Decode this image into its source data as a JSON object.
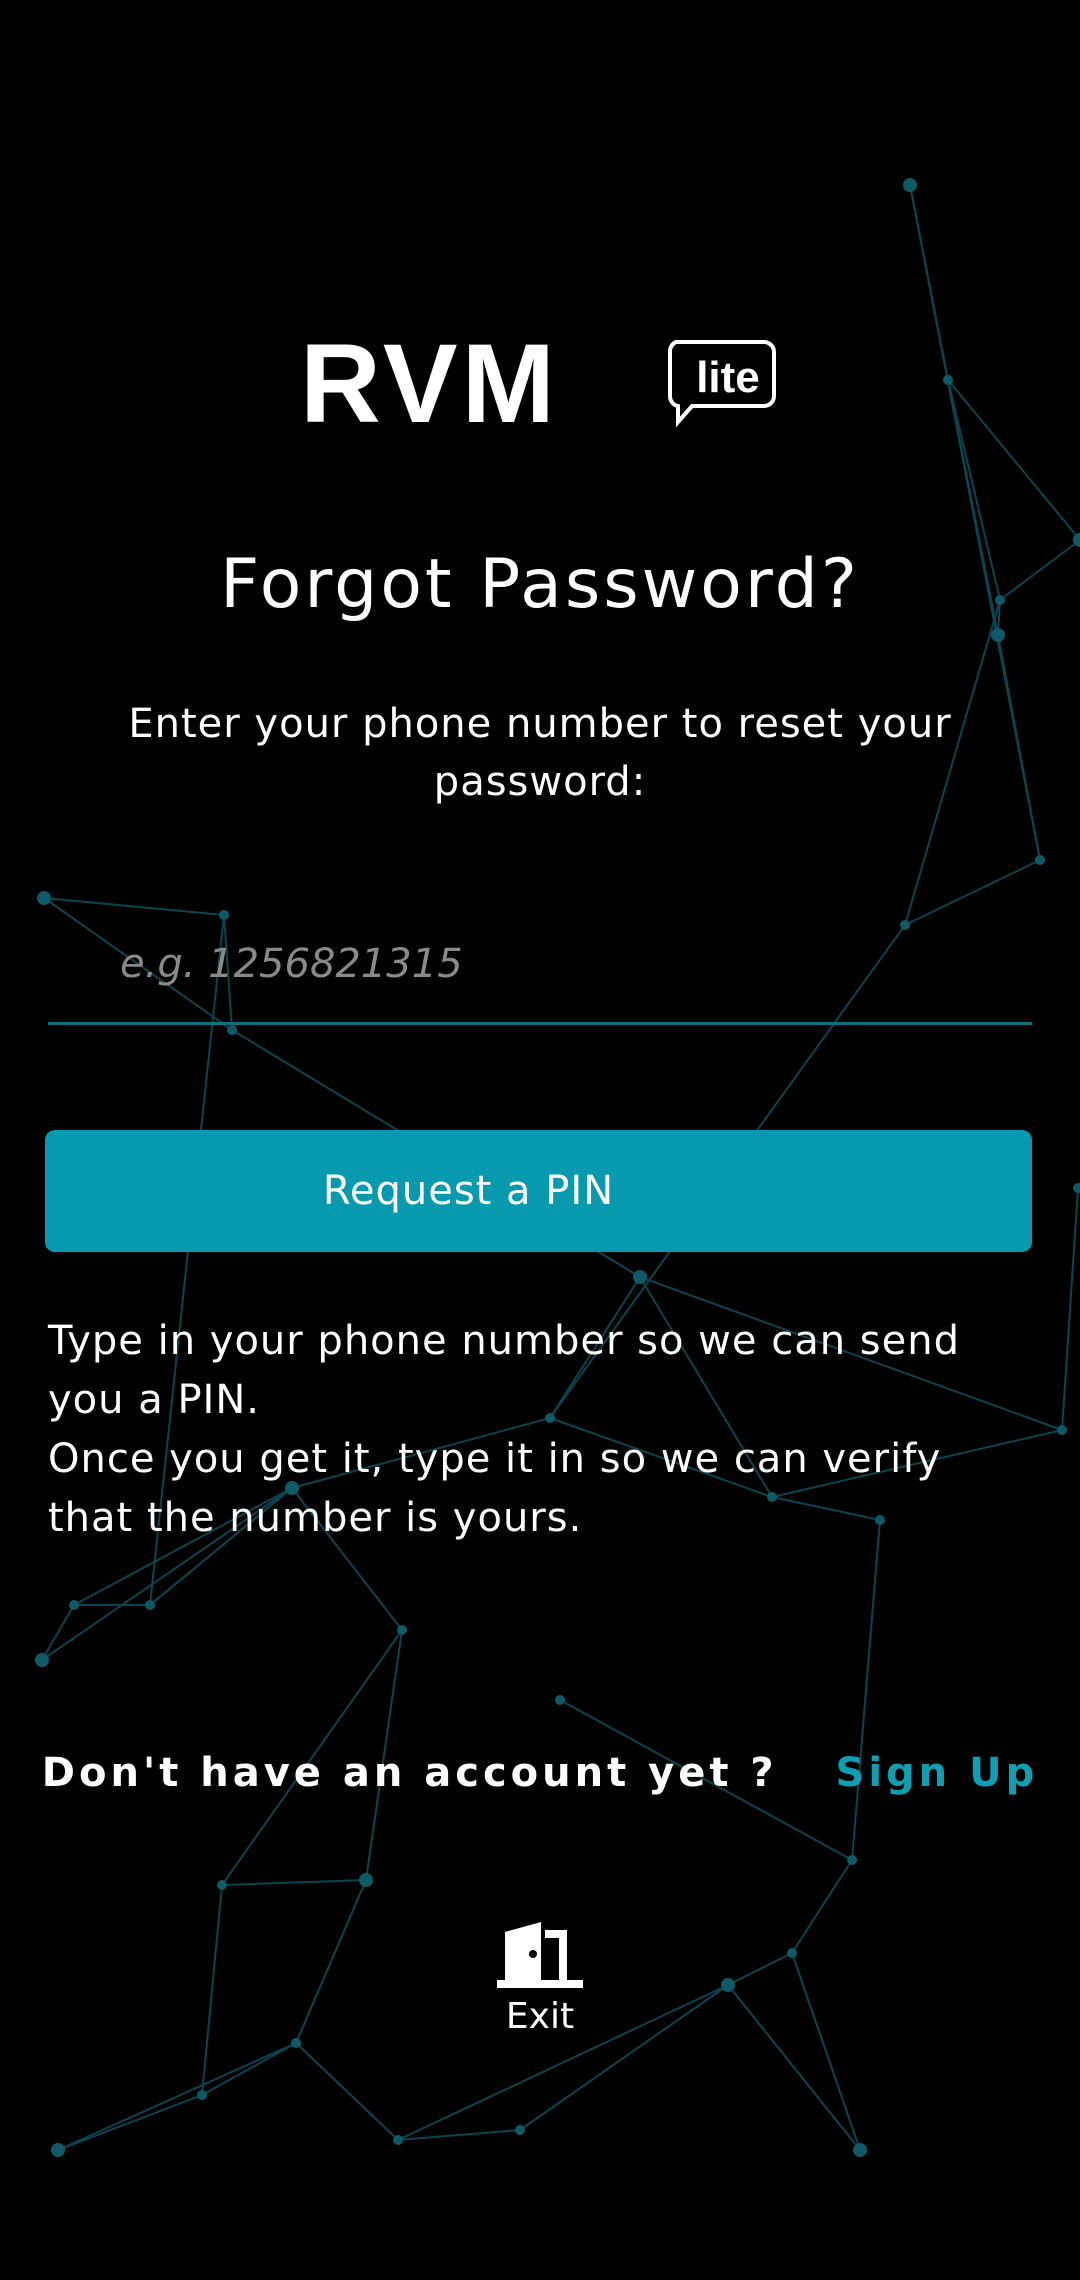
{
  "logo": {
    "text": "RVM",
    "badge": "lite"
  },
  "title": "Forgot Password?",
  "subtitle": "Enter your phone number to reset your password:",
  "phone_input": {
    "value": "",
    "placeholder": "e.g. 1256821315"
  },
  "request_button": {
    "label": "Request a PIN"
  },
  "help": {
    "line1": "Type in your phone number so we can send you a PIN.",
    "line2": "Once you get it, type it in so we can verify that the number is yours."
  },
  "signup": {
    "question": "Don't have an account yet ?",
    "link": "Sign Up"
  },
  "exit": {
    "label": "Exit",
    "icon": "door-exit-icon"
  },
  "colors": {
    "background": "#000000",
    "accent": "#079aae",
    "link": "#0f9fb2",
    "network": "#0b4450"
  }
}
